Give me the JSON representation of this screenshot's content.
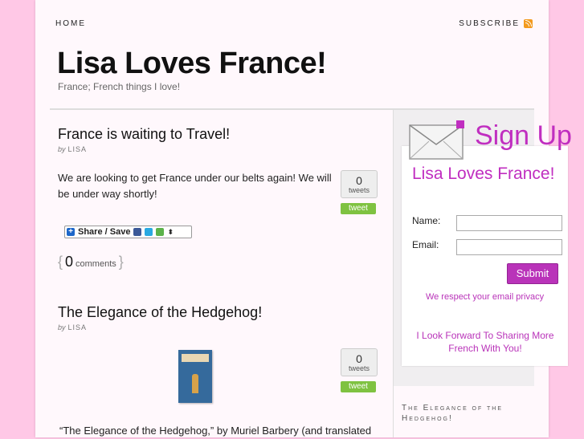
{
  "nav": {
    "home": "HOME",
    "subscribe": "SUBSCRIBE"
  },
  "site": {
    "title": "Lisa Loves France!",
    "tagline": "France; French things I love!"
  },
  "posts": [
    {
      "title": "France is waiting to Travel!",
      "by": "by",
      "author": "LISA",
      "body": "We are looking to get France under our belts again! We will be under way shortly!",
      "tweets": {
        "count": "0",
        "label": "tweets",
        "button": "tweet"
      }
    },
    {
      "title": "The Elegance of the Hedgehog!",
      "by": "by",
      "author": "LISA",
      "body": "“The Elegance of the Hedgehog,” by Muriel Barbery (and translated",
      "tweets": {
        "count": "0",
        "label": "tweets",
        "button": "tweet"
      }
    }
  ],
  "share": {
    "label": "Share / Save"
  },
  "comments": {
    "open": "{",
    "count": "0",
    "label": "comments",
    "close": "}"
  },
  "signup": {
    "header": "Sign Up",
    "list_title": "Lisa Loves France!",
    "name_label": "Name:",
    "email_label": "Email:",
    "submit": "Submit",
    "privacy": "We respect your email privacy",
    "forward": "I Look Forward To Sharing More French With You!"
  },
  "sidebar": {
    "recent_post": "The Elegance of the Hedgehog!"
  },
  "colors": {
    "background": "#ffc8e6",
    "accent": "#b933b9",
    "tweet_green": "#7fc241"
  }
}
